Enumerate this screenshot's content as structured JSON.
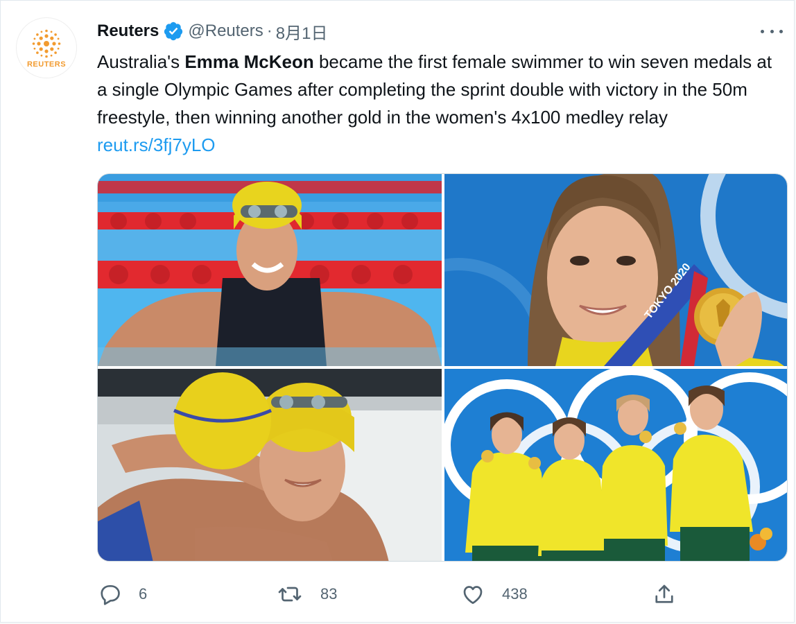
{
  "tweet": {
    "author": {
      "name": "Reuters",
      "handle": "@Reuters",
      "separator": "·",
      "date": "8月1日",
      "verified_icon": "verified-badge-icon",
      "avatar_text": "REUTERS"
    },
    "text": {
      "part1": "Australia's ",
      "bold": "Emma McKeon",
      "part2": " became the first female swimmer to win seven medals at a single Olympic Games after completing the sprint double with victory in the 50m freestyle, then winning another gold in the women's 4x100 medley relay ",
      "link": "reut.rs/3fj7yLO"
    },
    "medal_ribbon_text": "TOKYO 2020",
    "stats": {
      "replies": "6",
      "retweets": "83",
      "likes": "438"
    }
  },
  "colors": {
    "link": "#1d9bf0",
    "verified": "#1d9bf0",
    "text": "#0f1419",
    "muted": "#536471",
    "reuters_orange": "#f29b30"
  }
}
